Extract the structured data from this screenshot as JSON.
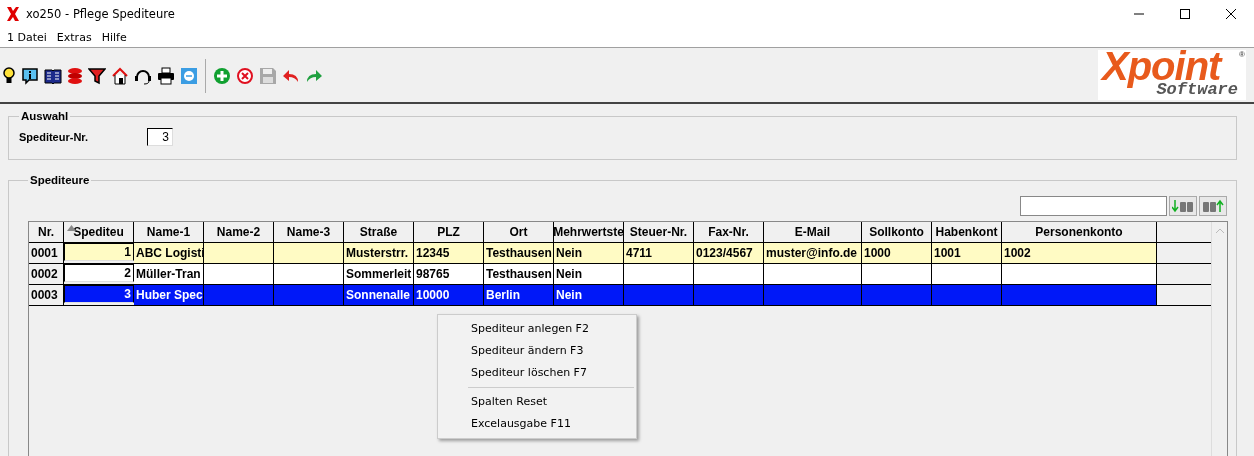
{
  "window": {
    "title": "xo250 - Pflege Spediteure"
  },
  "menu": [
    "1 Datei",
    "Extras",
    "Hilfe"
  ],
  "toolbar": [
    {
      "kind": "bulb"
    },
    {
      "kind": "info"
    },
    {
      "kind": "book"
    },
    {
      "kind": "stack"
    },
    {
      "kind": "filter"
    },
    {
      "kind": "house"
    },
    {
      "kind": "headset"
    },
    {
      "kind": "printer"
    },
    {
      "kind": "remote"
    },
    {
      "kind": "sep"
    },
    {
      "kind": "add"
    },
    {
      "kind": "delete"
    },
    {
      "kind": "save",
      "disabled": true
    },
    {
      "kind": "undo"
    },
    {
      "kind": "redo"
    }
  ],
  "logo": {
    "name": "Xpoint",
    "sub": "Software",
    "mark": "®"
  },
  "selection": {
    "title": "Auswahl",
    "label": "Spediteur-Nr.",
    "value": "3"
  },
  "list": {
    "title": "Spediteure",
    "columns": [
      {
        "label": "Nr.",
        "sorted": false
      },
      {
        "label": "Spediteu",
        "sorted": true
      },
      {
        "label": "Name-1",
        "sorted": false
      },
      {
        "label": "Name-2",
        "sorted": false
      },
      {
        "label": "Name-3",
        "sorted": false
      },
      {
        "label": "Straße",
        "sorted": false
      },
      {
        "label": "PLZ",
        "sorted": false
      },
      {
        "label": "Ort",
        "sorted": false
      },
      {
        "label": "Mehrwertste",
        "sorted": false
      },
      {
        "label": "Steuer-Nr.",
        "sorted": false
      },
      {
        "label": "Fax-Nr.",
        "sorted": false
      },
      {
        "label": "E-Mail",
        "sorted": false
      },
      {
        "label": "Sollkonto",
        "sorted": false
      },
      {
        "label": "Habenkont",
        "sorted": false
      },
      {
        "label": "Personenkonto",
        "sorted": false
      }
    ],
    "rows": [
      {
        "selected": false,
        "marked": true,
        "cells": [
          "0001",
          "1",
          "ABC Logisti",
          "",
          "",
          "Musterstrr.",
          "12345",
          "Testhausen",
          "Nein",
          "4711",
          "0123/4567",
          "muster@info.de",
          "1000",
          "1001",
          "1002"
        ]
      },
      {
        "selected": false,
        "marked": false,
        "cells": [
          "0002",
          "2",
          "Müller-Tran",
          "",
          "",
          "Sommerleit",
          "98765",
          "Testhausen",
          "Nein",
          "",
          "",
          "",
          "",
          "",
          ""
        ]
      },
      {
        "selected": true,
        "marked": false,
        "cells": [
          "0003",
          "3",
          "Huber Spec",
          "",
          "",
          "Sonnenalle",
          "10000",
          "Berlin",
          "Nein",
          "",
          "",
          "",
          "",
          "",
          ""
        ]
      }
    ]
  },
  "context_menu": [
    {
      "kind": "item",
      "label": "Spediteur anlegen F2"
    },
    {
      "kind": "item",
      "label": "Spediteur ändern F3"
    },
    {
      "kind": "item",
      "label": "Spediteur löschen F7"
    },
    {
      "kind": "separator"
    },
    {
      "kind": "item",
      "label": "Spalten Reset"
    },
    {
      "kind": "item",
      "label": "Excelausgabe F11"
    }
  ]
}
